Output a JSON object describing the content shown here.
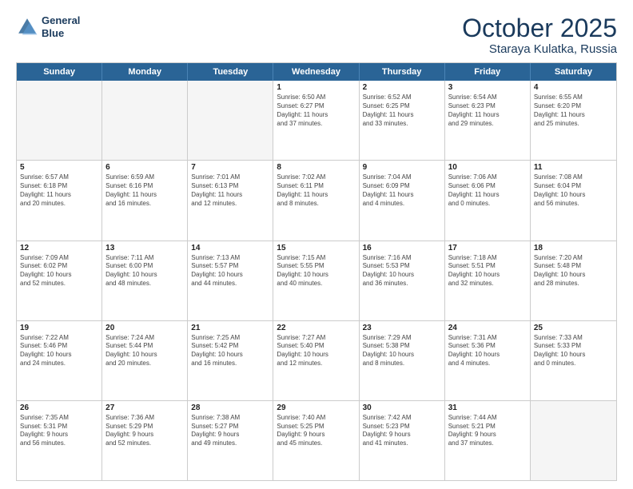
{
  "header": {
    "logo_line1": "General",
    "logo_line2": "Blue",
    "month": "October 2025",
    "location": "Staraya Kulatka, Russia"
  },
  "days_of_week": [
    "Sunday",
    "Monday",
    "Tuesday",
    "Wednesday",
    "Thursday",
    "Friday",
    "Saturday"
  ],
  "weeks": [
    [
      {
        "day": "",
        "text": ""
      },
      {
        "day": "",
        "text": ""
      },
      {
        "day": "",
        "text": ""
      },
      {
        "day": "1",
        "text": "Sunrise: 6:50 AM\nSunset: 6:27 PM\nDaylight: 11 hours\nand 37 minutes."
      },
      {
        "day": "2",
        "text": "Sunrise: 6:52 AM\nSunset: 6:25 PM\nDaylight: 11 hours\nand 33 minutes."
      },
      {
        "day": "3",
        "text": "Sunrise: 6:54 AM\nSunset: 6:23 PM\nDaylight: 11 hours\nand 29 minutes."
      },
      {
        "day": "4",
        "text": "Sunrise: 6:55 AM\nSunset: 6:20 PM\nDaylight: 11 hours\nand 25 minutes."
      }
    ],
    [
      {
        "day": "5",
        "text": "Sunrise: 6:57 AM\nSunset: 6:18 PM\nDaylight: 11 hours\nand 20 minutes."
      },
      {
        "day": "6",
        "text": "Sunrise: 6:59 AM\nSunset: 6:16 PM\nDaylight: 11 hours\nand 16 minutes."
      },
      {
        "day": "7",
        "text": "Sunrise: 7:01 AM\nSunset: 6:13 PM\nDaylight: 11 hours\nand 12 minutes."
      },
      {
        "day": "8",
        "text": "Sunrise: 7:02 AM\nSunset: 6:11 PM\nDaylight: 11 hours\nand 8 minutes."
      },
      {
        "day": "9",
        "text": "Sunrise: 7:04 AM\nSunset: 6:09 PM\nDaylight: 11 hours\nand 4 minutes."
      },
      {
        "day": "10",
        "text": "Sunrise: 7:06 AM\nSunset: 6:06 PM\nDaylight: 11 hours\nand 0 minutes."
      },
      {
        "day": "11",
        "text": "Sunrise: 7:08 AM\nSunset: 6:04 PM\nDaylight: 10 hours\nand 56 minutes."
      }
    ],
    [
      {
        "day": "12",
        "text": "Sunrise: 7:09 AM\nSunset: 6:02 PM\nDaylight: 10 hours\nand 52 minutes."
      },
      {
        "day": "13",
        "text": "Sunrise: 7:11 AM\nSunset: 6:00 PM\nDaylight: 10 hours\nand 48 minutes."
      },
      {
        "day": "14",
        "text": "Sunrise: 7:13 AM\nSunset: 5:57 PM\nDaylight: 10 hours\nand 44 minutes."
      },
      {
        "day": "15",
        "text": "Sunrise: 7:15 AM\nSunset: 5:55 PM\nDaylight: 10 hours\nand 40 minutes."
      },
      {
        "day": "16",
        "text": "Sunrise: 7:16 AM\nSunset: 5:53 PM\nDaylight: 10 hours\nand 36 minutes."
      },
      {
        "day": "17",
        "text": "Sunrise: 7:18 AM\nSunset: 5:51 PM\nDaylight: 10 hours\nand 32 minutes."
      },
      {
        "day": "18",
        "text": "Sunrise: 7:20 AM\nSunset: 5:48 PM\nDaylight: 10 hours\nand 28 minutes."
      }
    ],
    [
      {
        "day": "19",
        "text": "Sunrise: 7:22 AM\nSunset: 5:46 PM\nDaylight: 10 hours\nand 24 minutes."
      },
      {
        "day": "20",
        "text": "Sunrise: 7:24 AM\nSunset: 5:44 PM\nDaylight: 10 hours\nand 20 minutes."
      },
      {
        "day": "21",
        "text": "Sunrise: 7:25 AM\nSunset: 5:42 PM\nDaylight: 10 hours\nand 16 minutes."
      },
      {
        "day": "22",
        "text": "Sunrise: 7:27 AM\nSunset: 5:40 PM\nDaylight: 10 hours\nand 12 minutes."
      },
      {
        "day": "23",
        "text": "Sunrise: 7:29 AM\nSunset: 5:38 PM\nDaylight: 10 hours\nand 8 minutes."
      },
      {
        "day": "24",
        "text": "Sunrise: 7:31 AM\nSunset: 5:36 PM\nDaylight: 10 hours\nand 4 minutes."
      },
      {
        "day": "25",
        "text": "Sunrise: 7:33 AM\nSunset: 5:33 PM\nDaylight: 10 hours\nand 0 minutes."
      }
    ],
    [
      {
        "day": "26",
        "text": "Sunrise: 7:35 AM\nSunset: 5:31 PM\nDaylight: 9 hours\nand 56 minutes."
      },
      {
        "day": "27",
        "text": "Sunrise: 7:36 AM\nSunset: 5:29 PM\nDaylight: 9 hours\nand 52 minutes."
      },
      {
        "day": "28",
        "text": "Sunrise: 7:38 AM\nSunset: 5:27 PM\nDaylight: 9 hours\nand 49 minutes."
      },
      {
        "day": "29",
        "text": "Sunrise: 7:40 AM\nSunset: 5:25 PM\nDaylight: 9 hours\nand 45 minutes."
      },
      {
        "day": "30",
        "text": "Sunrise: 7:42 AM\nSunset: 5:23 PM\nDaylight: 9 hours\nand 41 minutes."
      },
      {
        "day": "31",
        "text": "Sunrise: 7:44 AM\nSunset: 5:21 PM\nDaylight: 9 hours\nand 37 minutes."
      },
      {
        "day": "",
        "text": ""
      }
    ]
  ]
}
